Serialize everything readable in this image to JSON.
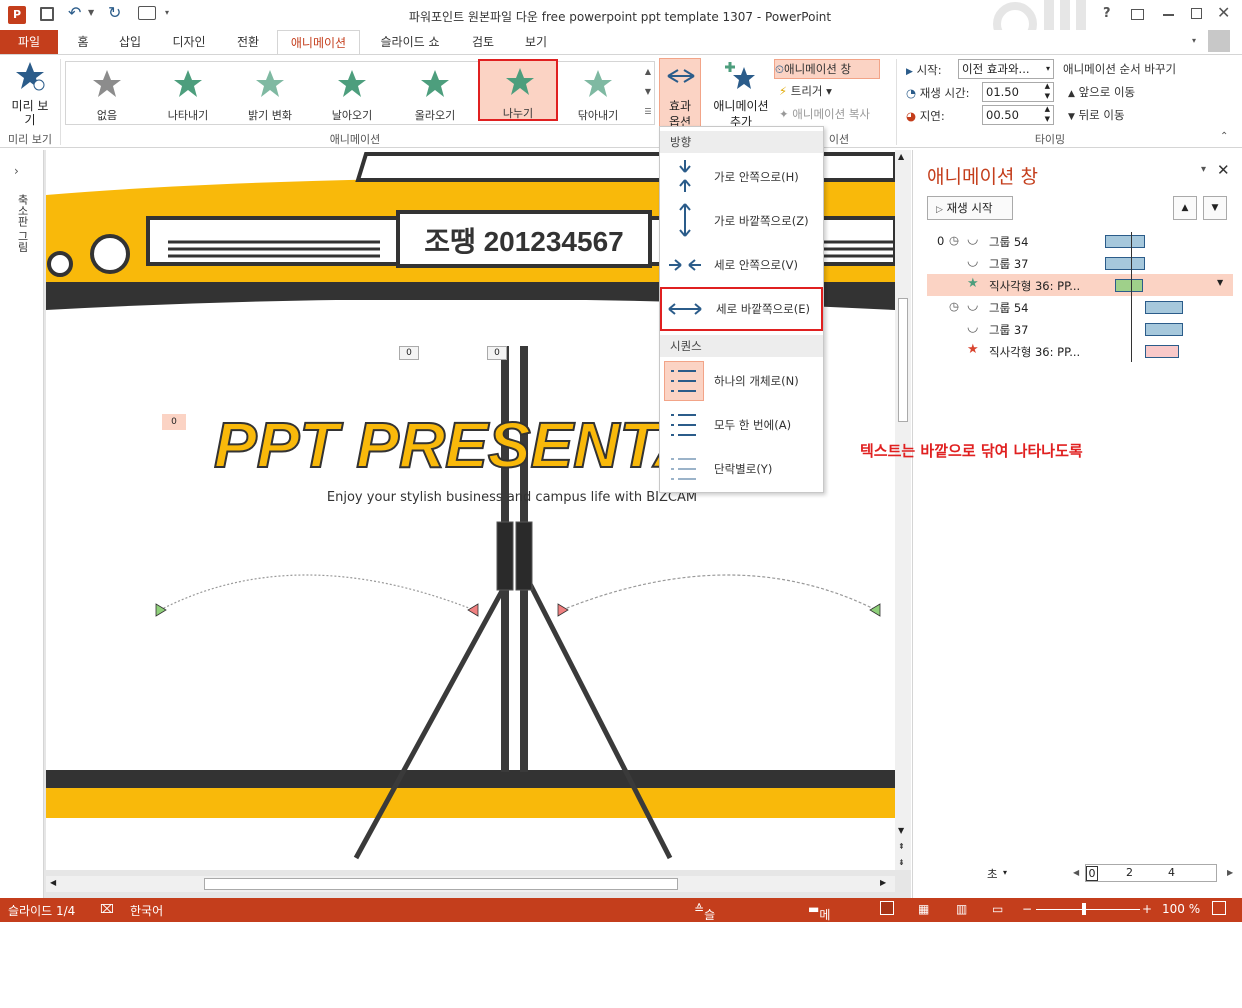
{
  "window": {
    "title": "파워포인트 원본파일 다운 free powerpoint ppt template 1307 - PowerPoint",
    "help": "?",
    "app_icon": "P"
  },
  "tabs": [
    "파일",
    "홈",
    "삽입",
    "디자인",
    "전환",
    "애니메이션",
    "슬라이드 쇼",
    "검토",
    "보기"
  ],
  "ribbon": {
    "preview": {
      "label1": "미리 보",
      "label2": "기",
      "group": "미리 보기"
    },
    "gallery": [
      {
        "label": "없음",
        "color": "#8c8c8c"
      },
      {
        "label": "나타내기",
        "color": "#4d9e7d"
      },
      {
        "label": "밝기 변화",
        "color": "#7fb9a2"
      },
      {
        "label": "날아오기",
        "color": "#4d9e7d"
      },
      {
        "label": "올라오기",
        "color": "#4d9e7d"
      },
      {
        "label": "나누기",
        "color": "#4d9e7d"
      },
      {
        "label": "닦아내기",
        "color": "#7fb9a2"
      }
    ],
    "animation_group": "애니메이션",
    "effect_options": {
      "l1": "효과",
      "l2": "옵션"
    },
    "add_animation": {
      "l1": "애니메이션",
      "l2": "추가"
    },
    "anim_pane_btn": "애니메이션 창",
    "trigger_btn": "트리거",
    "anim_painter_btn": "애니메이션 복사",
    "adv_group_tail": "이션",
    "timing": {
      "start_label": "시작:",
      "start_value": "이전 효과와...",
      "duration_label": "재생 시간:",
      "duration_value": "01.50",
      "delay_label": "지연:",
      "delay_value": "00.50",
      "group": "타이밍",
      "reorder_title": "애니메이션 순서 바꾸기",
      "move_earlier": "앞으로 이동",
      "move_later": "뒤로 이동"
    }
  },
  "dropdown": {
    "direction_header": "방향",
    "items": [
      {
        "label": "가로 안쪽으로(H)"
      },
      {
        "label": "가로 바깥쪽으로(Z)"
      },
      {
        "label": "세로 안쪽으로(V)"
      },
      {
        "label": "세로 바깥쪽으로(E)"
      }
    ],
    "sequence_header": "시퀀스",
    "seq_items": [
      {
        "label": "하나의 개체로(N)"
      },
      {
        "label": "모두 한 번에(A)"
      },
      {
        "label": "단락별로(Y)"
      }
    ]
  },
  "slide": {
    "badge_text": "조땡 201234567",
    "title": "PPT PRESENTA",
    "subtitle": "Enjoy your stylish business and campus life with BIZCAM",
    "anim_tags": [
      "0",
      "0",
      "0"
    ]
  },
  "thumb_pane_label": "축소판 그림",
  "annotation": "텍스트는 바깥으로 닦여 나타나도록",
  "anim_pane": {
    "title": "애니메이션 창",
    "play_btn": "재생 시작",
    "rows": [
      {
        "num": "0",
        "name": "그룹 54",
        "bar_color": "#a6c8dc"
      },
      {
        "num": "",
        "name": "그룹 37",
        "bar_color": "#a6c8dc"
      },
      {
        "num": "",
        "name": "직사각형 36: PP...",
        "bar_color": "#9fd08a"
      },
      {
        "num": "",
        "name": "그룹 54",
        "bar_color": "#a6c8dc"
      },
      {
        "num": "",
        "name": "그룹 37",
        "bar_color": "#a6c8dc"
      },
      {
        "num": "",
        "name": "직사각형 36: PP...",
        "bar_color": "#f9c9c9"
      }
    ],
    "seconds": "초",
    "timeline": [
      "0",
      "2",
      "4"
    ]
  },
  "status": {
    "slide": "슬라이드 1/4",
    "lang": "한국어",
    "notes": "슬라이드 노트",
    "comments": "메모",
    "zoom": "100 %"
  },
  "colors": {
    "accent": "#c43e1c",
    "yellow": "#f9b90a",
    "dark": "#333333",
    "highlight": "#fbd3c4"
  }
}
